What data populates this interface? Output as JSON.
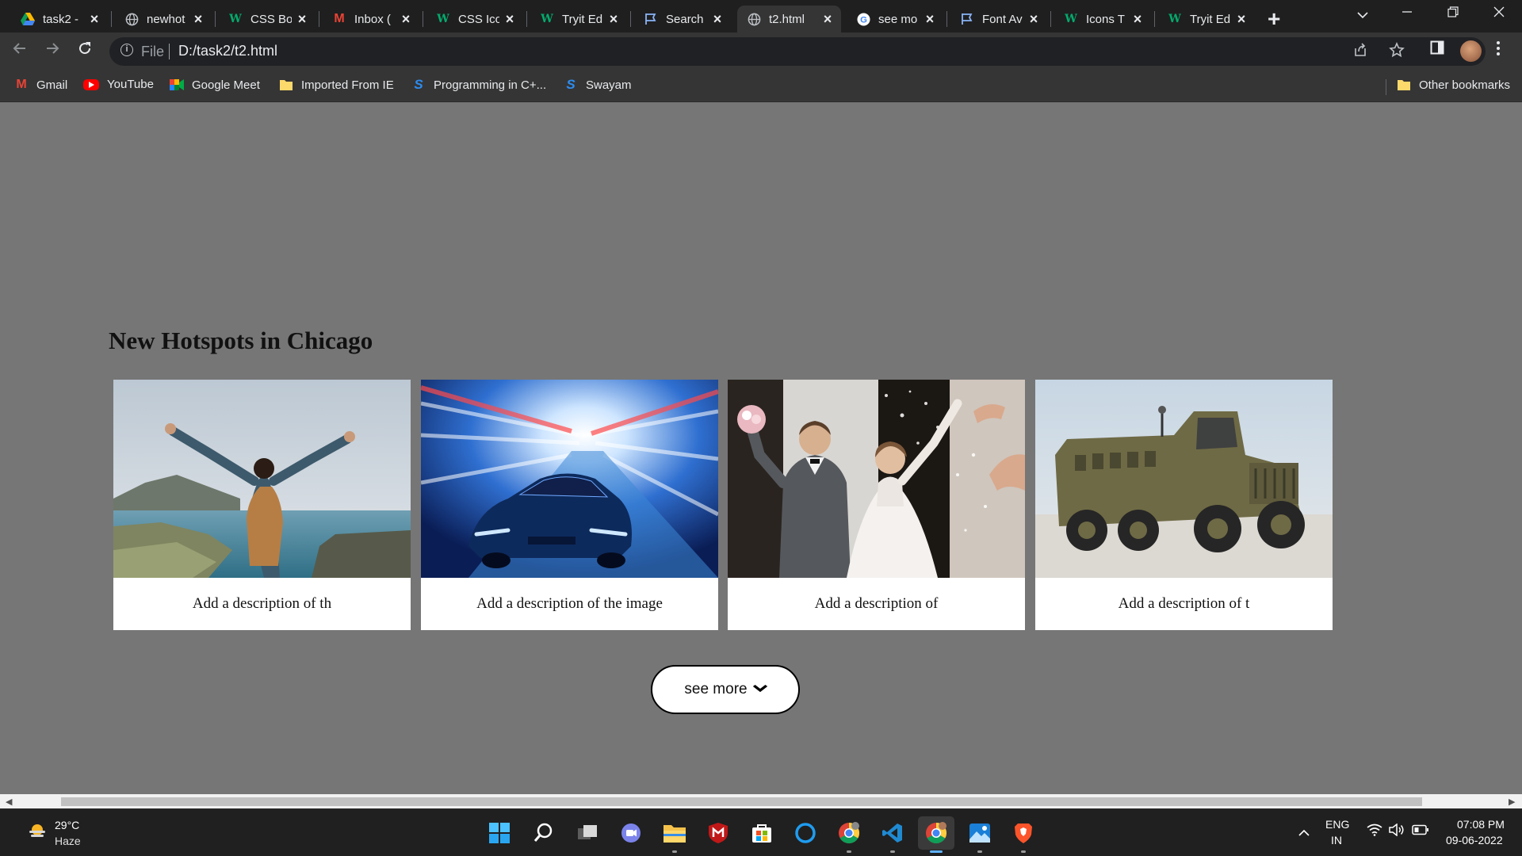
{
  "browser": {
    "tabs": [
      {
        "title": "task2 - ",
        "icon": "google-drive-icon",
        "active": false
      },
      {
        "title": "newhot",
        "icon": "globe-icon",
        "active": false
      },
      {
        "title": "CSS Bo",
        "icon": "w3schools-icon",
        "active": false
      },
      {
        "title": "Inbox (",
        "icon": "gmail-icon",
        "active": false
      },
      {
        "title": "CSS Ico",
        "icon": "w3schools-icon",
        "active": false
      },
      {
        "title": "Tryit Ed",
        "icon": "w3schools-icon",
        "active": false
      },
      {
        "title": "Search",
        "icon": "flag-icon",
        "active": false
      },
      {
        "title": "t2.html",
        "icon": "globe-icon",
        "active": true
      },
      {
        "title": "see mo",
        "icon": "google-icon",
        "active": false
      },
      {
        "title": "Font Av",
        "icon": "flag-icon",
        "active": false
      },
      {
        "title": "Icons T",
        "icon": "w3schools-icon",
        "active": false
      },
      {
        "title": "Tryit Ed",
        "icon": "w3schools-icon",
        "active": false
      }
    ],
    "address": {
      "scheme_label": "File",
      "url": "D:/task2/t2.html"
    },
    "bookmarks": [
      {
        "label": "Gmail",
        "icon": "gmail-icon"
      },
      {
        "label": "YouTube",
        "icon": "youtube-icon"
      },
      {
        "label": "Google Meet",
        "icon": "google-meet-icon"
      },
      {
        "label": "Imported From IE",
        "icon": "folder-icon"
      },
      {
        "label": "Programming in C+...",
        "icon": "swayam-icon"
      },
      {
        "label": "Swayam",
        "icon": "swayam-icon"
      }
    ],
    "other_bookmarks": "Other bookmarks"
  },
  "page": {
    "heading": "New Hotspots in Chicago",
    "cards": [
      {
        "caption": "Add a description of th",
        "image": "traveler on cliff overlooking sea"
      },
      {
        "caption": "Add a description of the image",
        "image": "blue sports car in light tunnel"
      },
      {
        "caption": "Add a description of",
        "image": "wedding couple celebrating"
      },
      {
        "caption": "Add a description of t",
        "image": "armored military truck"
      }
    ],
    "see_more_label": "see more",
    "background_color": "#767676"
  },
  "taskbar": {
    "temperature": "29°C",
    "weather": "Haze",
    "lang_line1": "ENG",
    "lang_line2": "IN",
    "time": "07:08 PM",
    "date": "09-06-2022"
  }
}
